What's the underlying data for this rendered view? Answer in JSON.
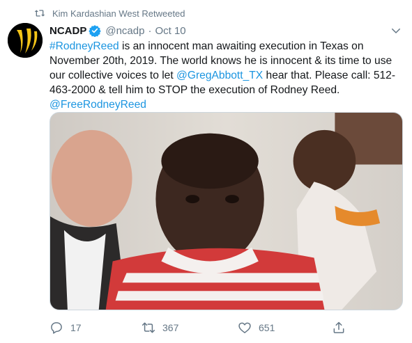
{
  "retweet_banner": {
    "text": "Kim Kardashian West Retweeted"
  },
  "author": {
    "display_name": "NCADP",
    "handle": "@ncadp",
    "date": "Oct 10",
    "separator": "·"
  },
  "tweet": {
    "lines": [
      [
        {
          "text": "#RodneyReed",
          "link": true
        },
        {
          "text": " is an innocent man awaiting execution in Texas on",
          "link": false
        }
      ],
      [
        {
          "text": "November 20th, 2019. The world knows he is innocent & its time to use",
          "link": false
        }
      ],
      [
        {
          "text": "our collective voices to let ",
          "link": false
        },
        {
          "text": "@GregAbbott_TX",
          "link": true
        },
        {
          "text": " hear that. Please call: 512-",
          "link": false
        }
      ],
      [
        {
          "text": "463-2000 & tell him to STOP the execution of Rodney Reed.",
          "link": false
        }
      ],
      [
        {
          "text": "@FreeRodneyReed",
          "link": true
        }
      ]
    ]
  },
  "actions": {
    "reply_count": "17",
    "retweet_count": "367",
    "like_count": "651"
  },
  "icons": {
    "retweet_banner": "retweet-icon",
    "verified": "verified-badge-icon",
    "chevron": "chevron-down-icon",
    "reply": "reply-icon",
    "retweet": "retweet-icon",
    "like": "heart-icon",
    "share": "share-icon"
  },
  "colors": {
    "link": "#1b95e0",
    "muted": "#657786",
    "verified": "#1da1f2",
    "text": "#14171a"
  }
}
